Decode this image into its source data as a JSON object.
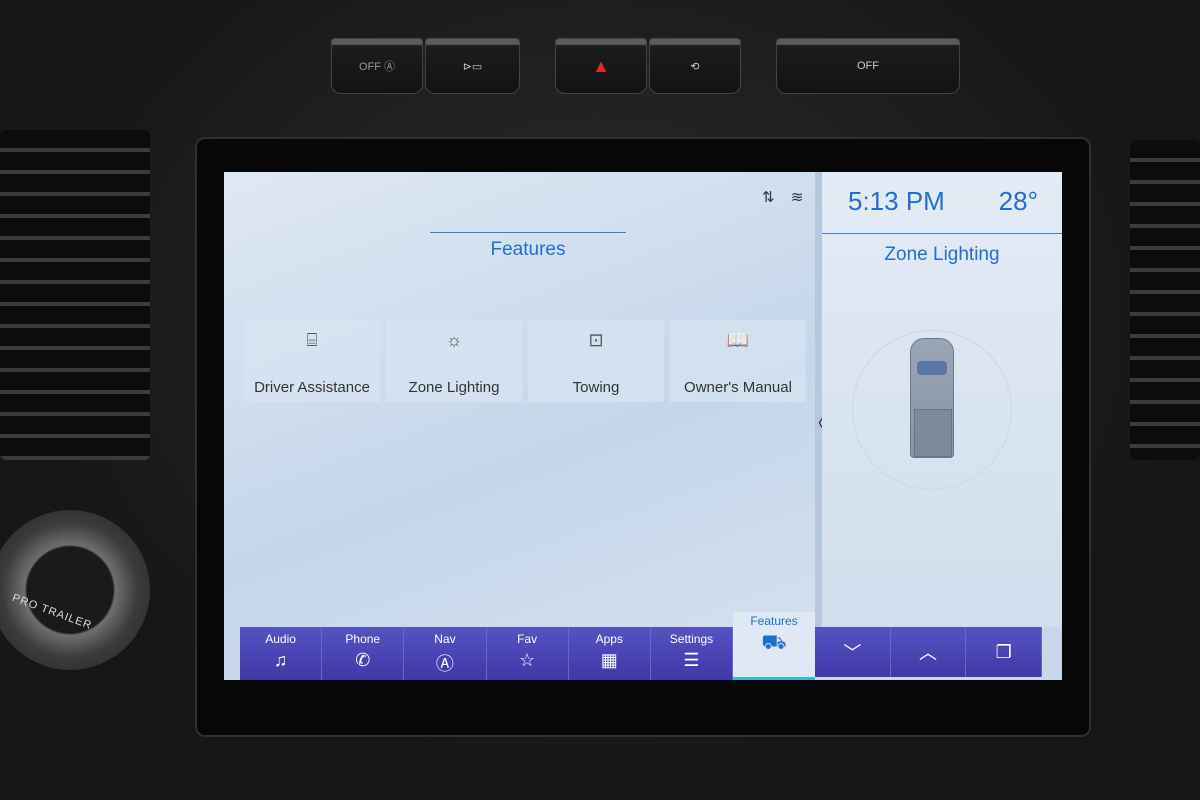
{
  "hardware_buttons": [
    {
      "label": "OFF Ⓐ",
      "icon": "auto-start-stop-icon"
    },
    {
      "label": "⊳▭",
      "icon": "camera-icon"
    },
    {
      "label": "▲",
      "icon": "hazard-icon",
      "color": "#e2262b"
    },
    {
      "label": "⟲",
      "icon": "hill-descent-icon"
    },
    {
      "label": "OFF",
      "icon": "traction-control-off-icon"
    }
  ],
  "knob_label": "PRO TRAILER",
  "status_icons": "⇅ ≋",
  "features": {
    "title": "Features",
    "tiles": [
      {
        "label": "Driver Assistance",
        "icon": "⌸"
      },
      {
        "label": "Zone Lighting",
        "icon": "☼"
      },
      {
        "label": "Towing",
        "icon": "⊡"
      },
      {
        "label": "Owner's Manual",
        "icon": "📖"
      }
    ],
    "collapse_icon": "〈"
  },
  "side_panel": {
    "time": "5:13 PM",
    "temperature": "28°",
    "title": "Zone Lighting"
  },
  "nav_bar": [
    {
      "label": "Audio",
      "icon": "♫"
    },
    {
      "label": "Phone",
      "icon": "✆"
    },
    {
      "label": "Nav",
      "icon": "Ⓐ"
    },
    {
      "label": "Fav",
      "icon": "☆"
    },
    {
      "label": "Apps",
      "icon": "▦"
    },
    {
      "label": "Settings",
      "icon": "☰"
    }
  ],
  "active_tab": {
    "label": "Features",
    "icon": "⛟"
  },
  "panel_controls": [
    {
      "icon": "﹀"
    },
    {
      "icon": "︿"
    },
    {
      "icon": "❐"
    }
  ],
  "colors": {
    "accent": "#1f6fd0",
    "nav_bar": "#4a45b4",
    "active_underline": "#36b8d8"
  }
}
